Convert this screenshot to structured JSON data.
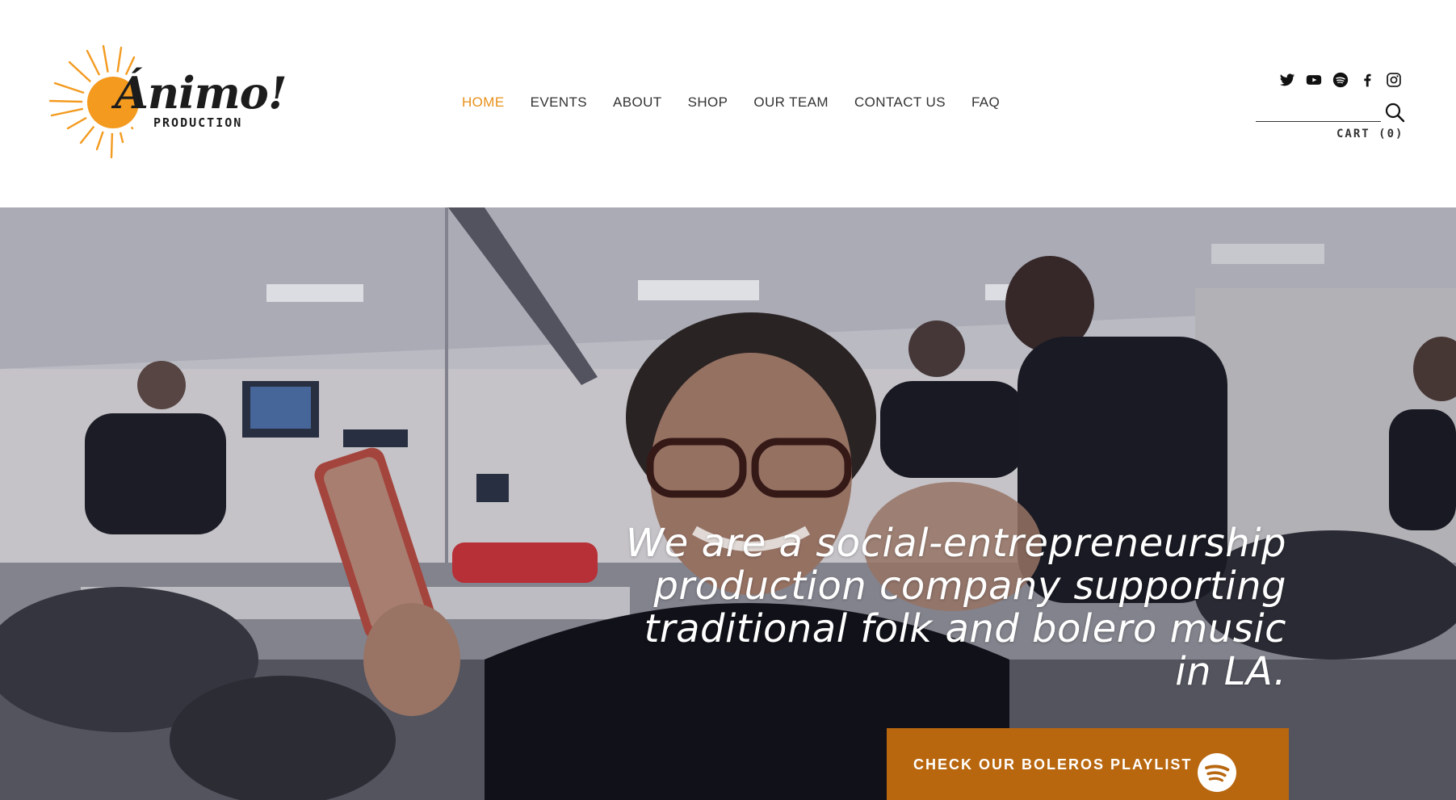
{
  "brand": {
    "logo_word": "Ánimo!",
    "logo_sub": "PRODUCTION",
    "accent_color": "#e8901a",
    "sun_color": "#f39a1f"
  },
  "nav": {
    "items": [
      {
        "label": "HOME",
        "active": true
      },
      {
        "label": "EVENTS",
        "active": false
      },
      {
        "label": "ABOUT",
        "active": false
      },
      {
        "label": "SHOP",
        "active": false
      },
      {
        "label": "OUR TEAM",
        "active": false
      },
      {
        "label": "CONTACT US",
        "active": false
      },
      {
        "label": "FAQ",
        "active": false
      }
    ]
  },
  "social": {
    "icons": [
      "twitter-icon",
      "youtube-icon",
      "spotify-icon",
      "facebook-icon",
      "instagram-icon"
    ]
  },
  "search": {
    "value": "",
    "placeholder": ""
  },
  "cart": {
    "label": "CART (0)"
  },
  "hero": {
    "lines": [
      "We are a social-entrepreneurship",
      "production company supporting",
      "traditional folk and bolero music",
      "in LA."
    ],
    "cta_label": "CHECK OUR BOLEROS PLAYLIST",
    "cta_color": "#b8670f"
  }
}
